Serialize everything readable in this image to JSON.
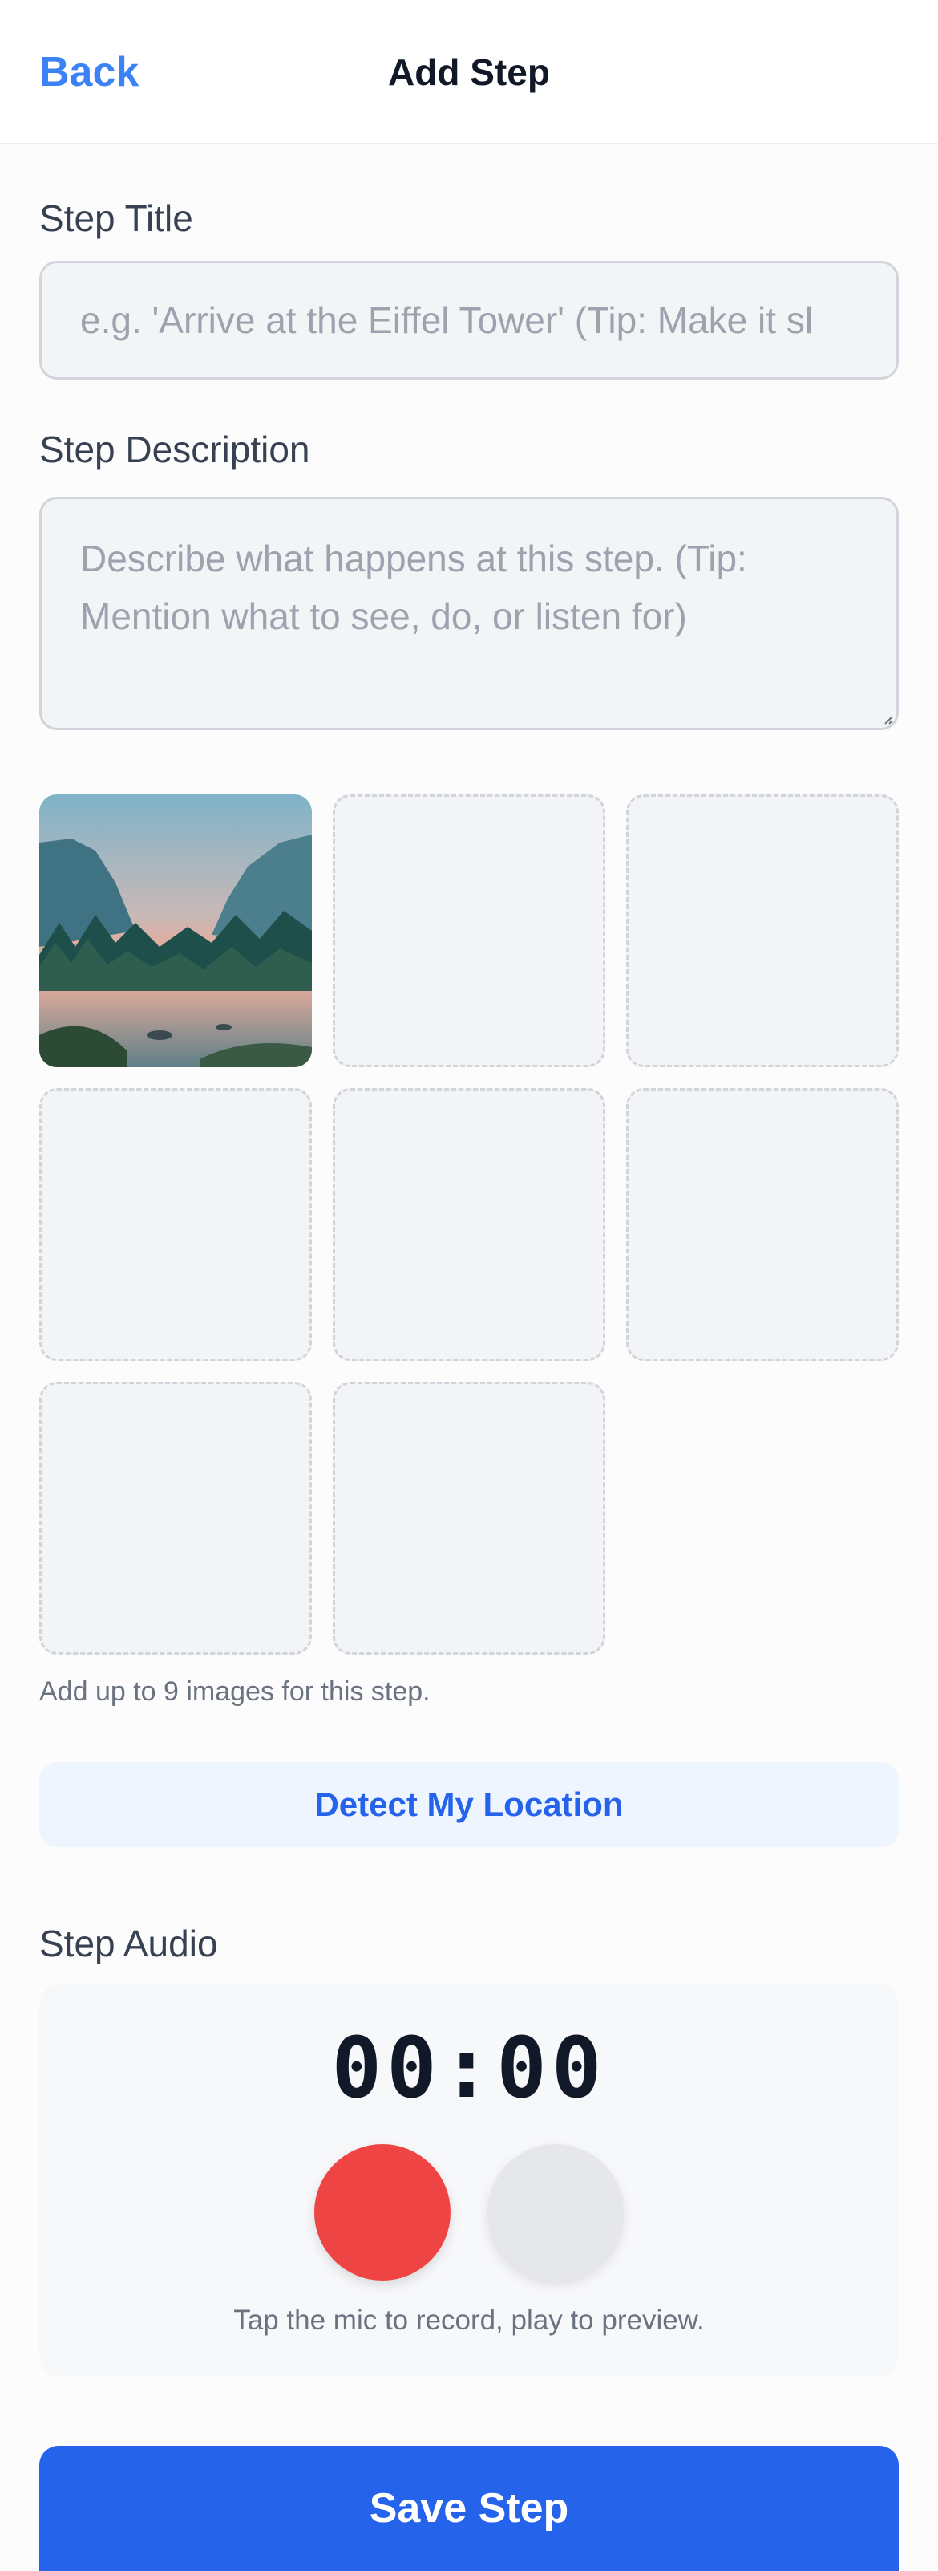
{
  "header": {
    "back_label": "Back",
    "title": "Add Step"
  },
  "form": {
    "step_title": {
      "label": "Step Title",
      "value": "",
      "placeholder": "e.g. 'Arrive at the Eiffel Tower' (Tip: Make it sl"
    },
    "step_description": {
      "label": "Step Description",
      "value": "",
      "placeholder": "Describe what happens at this step. (Tip: Mention what to see, do, or listen for)"
    },
    "images": {
      "slots": [
        {
          "filled": true,
          "image": "mountain-valley-sunset-photo"
        },
        {
          "filled": false
        },
        {
          "filled": false
        },
        {
          "filled": false
        },
        {
          "filled": false
        },
        {
          "filled": false
        },
        {
          "filled": false
        },
        {
          "filled": false
        }
      ],
      "hint": "Add up to 9 images for this step."
    },
    "detect_location_label": "Detect My Location",
    "audio": {
      "label": "Step Audio",
      "timer": "00:00",
      "record_icon": "microphone-record-button",
      "play_icon": "play-button",
      "hint": "Tap the mic to record, play to preview."
    },
    "save_label": "Save Step"
  },
  "colors": {
    "accent": "#3b82f6",
    "primary_button": "#2563eb",
    "record": "#ef4444",
    "play_disabled": "#e5e7eb"
  }
}
